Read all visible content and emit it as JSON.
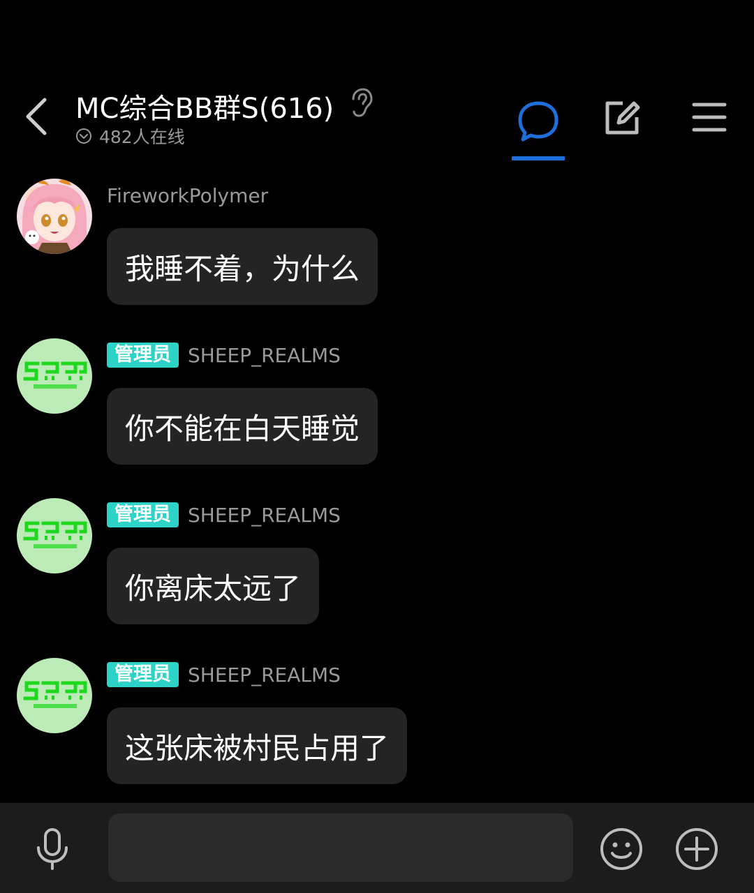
{
  "header": {
    "title": "MC综合BB群S(616)",
    "online_text": "482人在线"
  },
  "colors": {
    "accent": "#1e6fd9",
    "badge": "#2ed3c8",
    "bubble": "#242424",
    "background": "#000000",
    "input_bar": "#1c1c1c"
  },
  "messages": [
    {
      "sender": "FireworkPolymer",
      "role": "",
      "text": "我睡不着，为什么",
      "avatar": "anime-girl-avatar"
    },
    {
      "sender": "SHEEP_REALMS",
      "role": "管理员",
      "text": "你不能在白天睡觉",
      "avatar": "sheep-realms-logo"
    },
    {
      "sender": "SHEEP_REALMS",
      "role": "管理员",
      "text": "你离床太远了",
      "avatar": "sheep-realms-logo"
    },
    {
      "sender": "SHEEP_REALMS",
      "role": "管理员",
      "text": "这张床被村民占用了",
      "avatar": "sheep-realms-logo"
    }
  ],
  "input": {
    "value": "",
    "placeholder": ""
  },
  "icons": {
    "back": "chevron-left-icon",
    "listen": "ear-icon",
    "online": "chevron-down-circle-icon",
    "chat": "chat-bubble-icon",
    "edit": "edit-icon",
    "menu": "menu-icon",
    "mic": "microphone-icon",
    "emoji": "emoji-icon",
    "plus": "plus-circle-icon"
  }
}
